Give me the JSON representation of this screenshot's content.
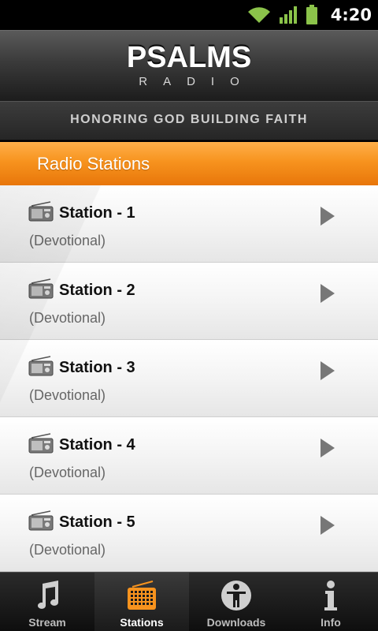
{
  "status_bar": {
    "time": "4:20",
    "icons": [
      "wifi-icon",
      "signal-icon",
      "battery-icon"
    ],
    "accent": "#8bc34a"
  },
  "header": {
    "logo_main": "PSALMS",
    "logo_sub": "RADIO",
    "tagline": "HONORING GOD BUILDING FAITH"
  },
  "section": {
    "title": "Radio Stations",
    "color": "#f7931e"
  },
  "stations": [
    {
      "name": "Station - 1",
      "genre": "(Devotional)"
    },
    {
      "name": "Station - 2",
      "genre": "(Devotional)"
    },
    {
      "name": "Station - 3",
      "genre": "(Devotional)"
    },
    {
      "name": "Station - 4",
      "genre": "(Devotional)"
    },
    {
      "name": "Station - 5",
      "genre": "(Devotional)"
    }
  ],
  "tabs": [
    {
      "label": "Stream",
      "icon": "music-note-icon",
      "active": false
    },
    {
      "label": "Stations",
      "icon": "radio-icon",
      "active": true
    },
    {
      "label": "Downloads",
      "icon": "person-icon",
      "active": false
    },
    {
      "label": "Info",
      "icon": "info-icon",
      "active": false
    }
  ]
}
